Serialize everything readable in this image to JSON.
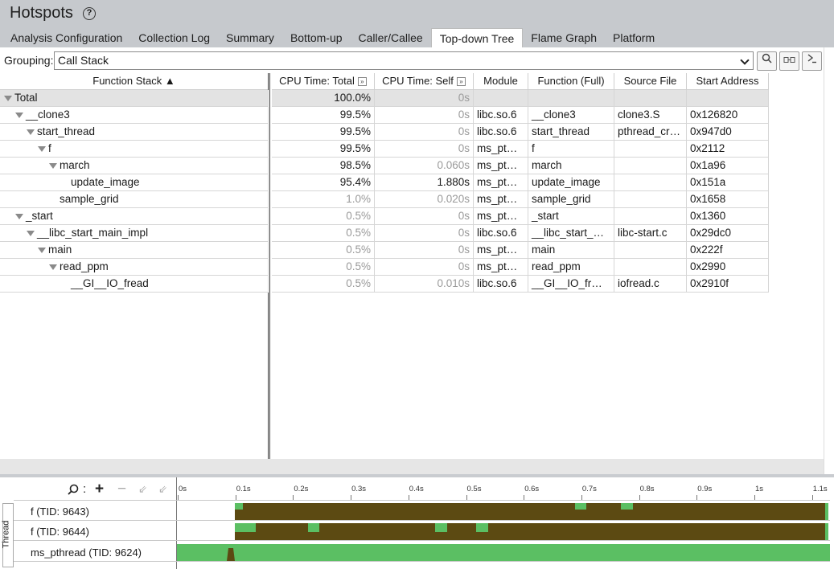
{
  "header": {
    "title": "Hotspots",
    "help_icon": "?"
  },
  "tabs": [
    {
      "label": "Analysis Configuration",
      "active": false
    },
    {
      "label": "Collection Log",
      "active": false
    },
    {
      "label": "Summary",
      "active": false
    },
    {
      "label": "Bottom-up",
      "active": false
    },
    {
      "label": "Caller/Callee",
      "active": false
    },
    {
      "label": "Top-down Tree",
      "active": true
    },
    {
      "label": "Flame Graph",
      "active": false
    },
    {
      "label": "Platform",
      "active": false
    }
  ],
  "grouping": {
    "label": "Grouping:",
    "value": "Call Stack"
  },
  "columns": {
    "function_stack": "Function Stack ▲",
    "cpu_total": "CPU Time: Total",
    "cpu_self": "CPU Time: Self",
    "module": "Module",
    "function_full": "Function (Full)",
    "source_file": "Source File",
    "start_address": "Start Address"
  },
  "rows": [
    {
      "name": "Total",
      "total": "100.0%",
      "self": "0s",
      "module": "",
      "func": "",
      "src": "",
      "addr": ""
    },
    {
      "name": "__clone3",
      "total": "99.5%",
      "self": "0s",
      "module": "libc.so.6",
      "func": "__clone3",
      "src": "clone3.S",
      "addr": "0x126820"
    },
    {
      "name": "start_thread",
      "total": "99.5%",
      "self": "0s",
      "module": "libc.so.6",
      "func": "start_thread",
      "src": "pthread_cr…",
      "addr": "0x947d0"
    },
    {
      "name": "f",
      "total": "99.5%",
      "self": "0s",
      "module": "ms_pt…",
      "func": "f",
      "src": "",
      "addr": "0x2112"
    },
    {
      "name": "march",
      "total": "98.5%",
      "self": "0.060s",
      "module": "ms_pt…",
      "func": "march",
      "src": "",
      "addr": "0x1a96"
    },
    {
      "name": "update_image",
      "total": "95.4%",
      "self": "1.880s",
      "module": "ms_pt…",
      "func": "update_image",
      "src": "",
      "addr": "0x151a"
    },
    {
      "name": "sample_grid",
      "total": "1.0%",
      "self": "0.020s",
      "module": "ms_pt…",
      "func": "sample_grid",
      "src": "",
      "addr": "0x1658"
    },
    {
      "name": "_start",
      "total": "0.5%",
      "self": "0s",
      "module": "ms_pt…",
      "func": "_start",
      "src": "",
      "addr": "0x1360"
    },
    {
      "name": "__libc_start_main_impl",
      "total": "0.5%",
      "self": "0s",
      "module": "libc.so.6",
      "func": "__libc_start_…",
      "src": "libc-start.c",
      "addr": "0x29dc0"
    },
    {
      "name": "main",
      "total": "0.5%",
      "self": "0s",
      "module": "ms_pt…",
      "func": "main",
      "src": "",
      "addr": "0x222f"
    },
    {
      "name": "read_ppm",
      "total": "0.5%",
      "self": "0s",
      "module": "ms_pt…",
      "func": "read_ppm",
      "src": "",
      "addr": "0x2990"
    },
    {
      "name": "__GI__IO_fread",
      "total": "0.5%",
      "self": "0.010s",
      "module": "libc.so.6",
      "func": "__GI__IO_fr…",
      "src": "iofread.c",
      "addr": "0x2910f"
    }
  ],
  "timeline": {
    "axis_labels": [
      "0s",
      "0.1s",
      "0.2s",
      "0.3s",
      "0.4s",
      "0.5s",
      "0.6s",
      "0.7s",
      "0.8s",
      "0.9s",
      "1s",
      "1.1s"
    ],
    "group_label": "Thread",
    "threads": [
      {
        "label": "f (TID: 9643)"
      },
      {
        "label": "f (TID: 9644)"
      },
      {
        "label": "ms_pthread (TID: 9624)"
      }
    ],
    "colors": {
      "cpu_dark": "#5c4a12",
      "cpu_green": "#5bbf63"
    }
  }
}
